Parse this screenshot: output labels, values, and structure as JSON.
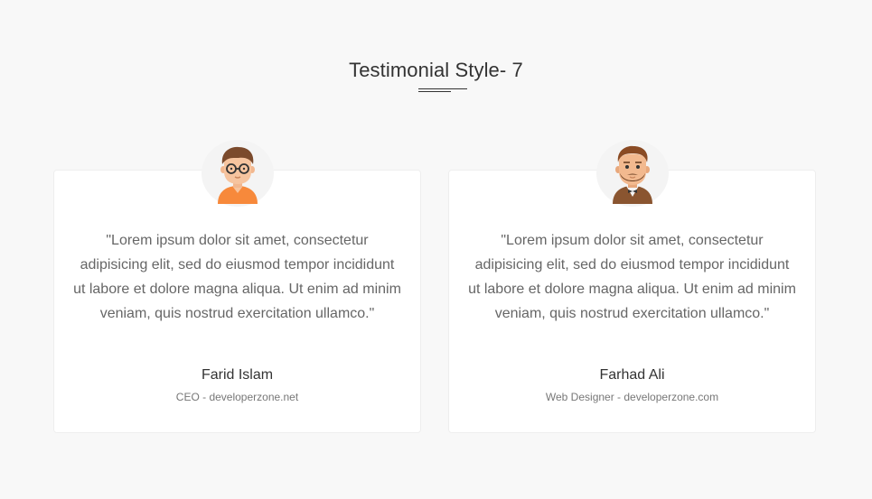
{
  "section": {
    "title": "Testimonial Style- 7"
  },
  "testimonials": [
    {
      "quote": "\"Lorem ipsum dolor sit amet, consectetur adipisicing elit, sed do eiusmod tempor incididunt ut labore et dolore magna aliqua. Ut enim ad minim veniam, quis nostrud exercitation ullamco.\"",
      "name": "Farid Islam",
      "role": "CEO - developerzone.net",
      "avatar_icon": "boy-with-glasses-avatar"
    },
    {
      "quote": "\"Lorem ipsum dolor sit amet, consectetur adipisicing elit, sed do eiusmod tempor incididunt ut labore et dolore magna aliqua. Ut enim ad minim veniam, quis nostrud exercitation ullamco.\"",
      "name": "Farhad Ali",
      "role": "Web Designer - developerzone.com",
      "avatar_icon": "bearded-man-avatar"
    }
  ],
  "colors": {
    "background": "#f8f8f8",
    "card": "#ffffff",
    "text_dark": "#333333",
    "text_muted": "#666666"
  }
}
